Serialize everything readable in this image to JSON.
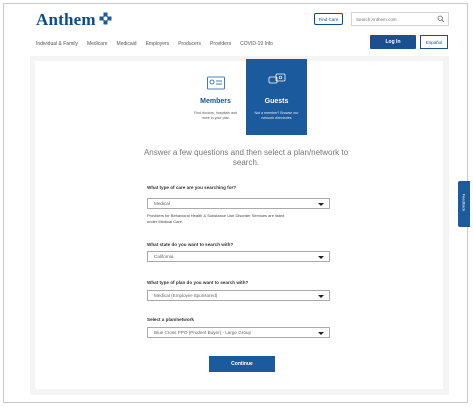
{
  "header": {
    "logo_text": "Anthem",
    "find_care_label": "Find Care",
    "search_placeholder": "Search Anthem.com",
    "login_label": "Log In",
    "espanol_label": "Español",
    "nav_items": [
      "Individual & Family",
      "Medicare",
      "Medicaid",
      "Employers",
      "Producers",
      "Providers",
      "COVID-19 Info"
    ]
  },
  "tabs": {
    "members": {
      "title": "Members",
      "desc": "Find doctors, hospitals and more in your plan"
    },
    "guests": {
      "title": "Guests",
      "desc": "Not a member? Browse our network directories"
    }
  },
  "main": {
    "headline": "Answer a few questions and then select a plan/network to search.",
    "q1_label": "What type of care are you searching for?",
    "q1_value": "Medical",
    "q1_note": "Providers for Behavioral Health & Substance Use Disorder Services are listed under Medical Care.",
    "q2_label": "What state do you want to search with?",
    "q2_value": "California",
    "q3_label": "What type of plan do you want to search with?",
    "q3_value": "Medical (Employer-Sponsored)",
    "q4_label": "Select a plan/network",
    "q4_value": "Blue Cross PPO (Prudent Buyer) - Large Group",
    "continue_label": "Continue"
  },
  "feedback_label": "Feedback",
  "colors": {
    "brand_blue": "#1b5a9c",
    "logo_blue": "#0b4c8c",
    "background": "#f4f4f4"
  }
}
